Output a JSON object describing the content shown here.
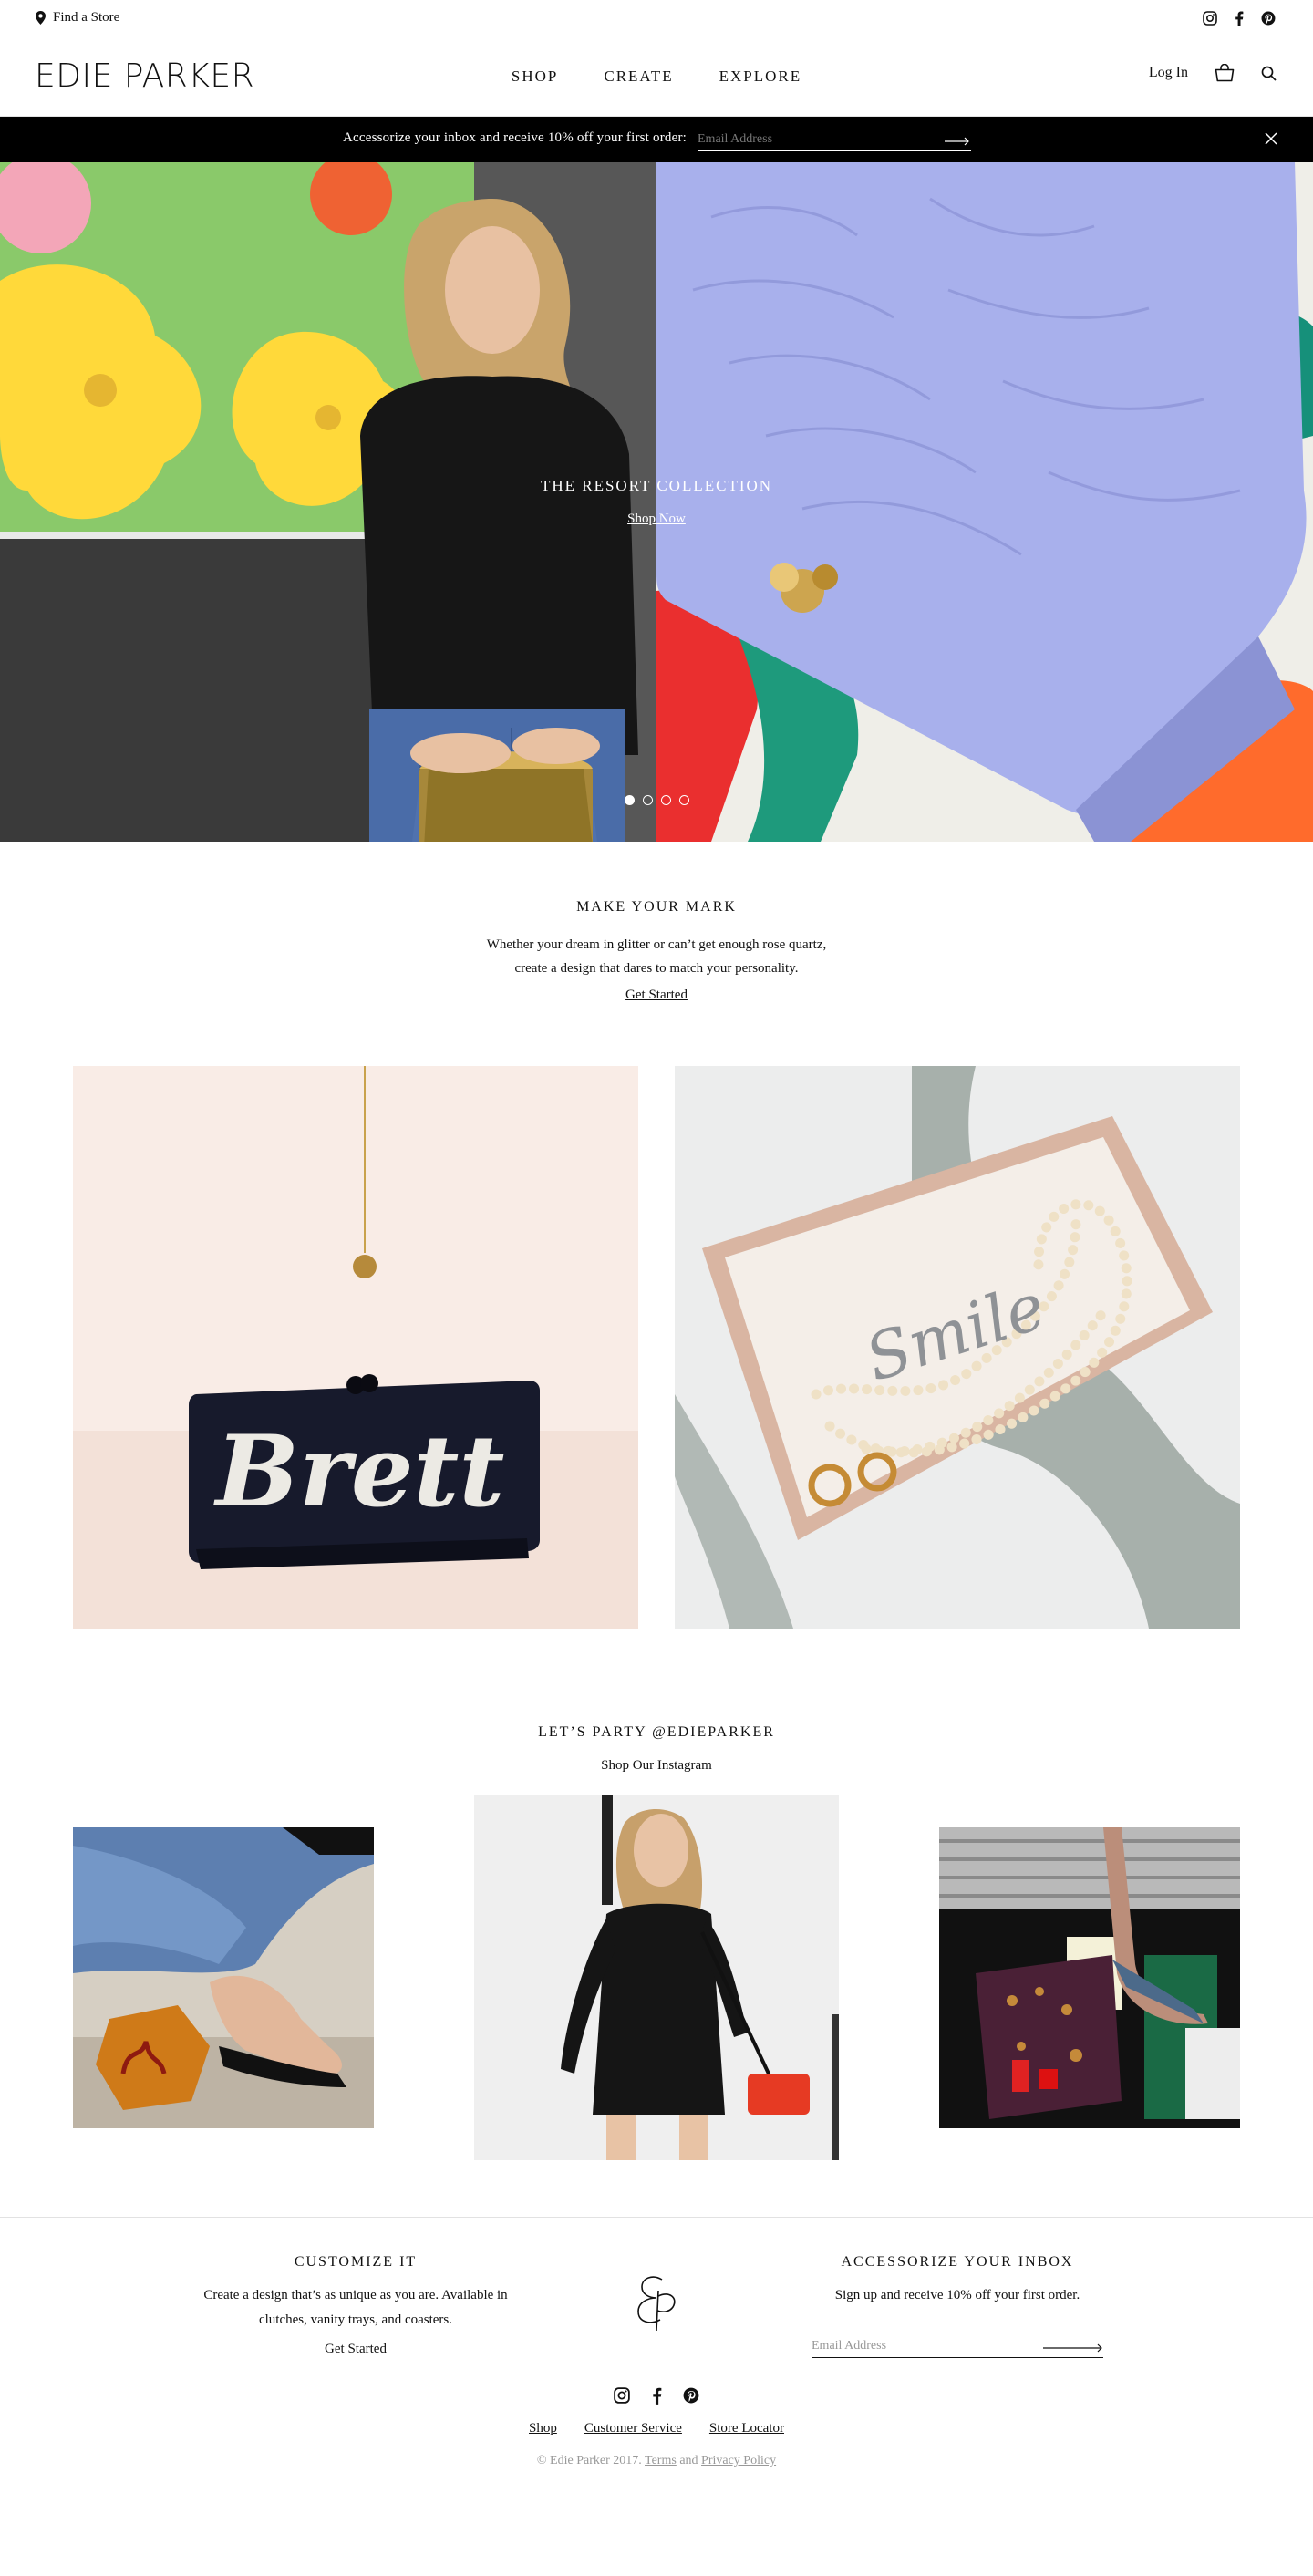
{
  "utility_bar": {
    "find_store": "Find a Store",
    "social": [
      "instagram-icon",
      "facebook-icon",
      "pinterest-icon"
    ]
  },
  "header": {
    "logo": "EDIE PARKER",
    "nav": [
      "SHOP",
      "CREATE",
      "EXPLORE"
    ],
    "login": "Log In",
    "icons": [
      "bag-icon",
      "search-icon"
    ]
  },
  "email_banner": {
    "text": "Accessorize your inbox and receive 10% off your first order:",
    "placeholder": "Email Address"
  },
  "hero": {
    "title": "THE RESORT COLLECTION",
    "link": "Shop Now",
    "slides": 4,
    "active_slide": 1
  },
  "make_your_mark": {
    "title": "MAKE YOUR MARK",
    "body_line1": "Whether your dream in glitter or can’t get enough rose quartz,",
    "body_line2": "create a design that dares to match your personality.",
    "link": "Get Started",
    "product_a_text": "Brett",
    "product_b_text": "Smile"
  },
  "instagram": {
    "title": "LET’S PARTY @EDIEPARKER",
    "subtitle": "Shop Our Instagram"
  },
  "footer": {
    "customize": {
      "title": "CUSTOMIZE IT",
      "body_line1": "Create a design that’s as unique as you are. Available in",
      "body_line2": "clutches, vanity trays, and coasters.",
      "link": "Get Started"
    },
    "newsletter": {
      "title": "ACCESSORIZE YOUR INBOX",
      "body": "Sign up and receive 10% off your first order.",
      "placeholder": "Email Address"
    },
    "links": [
      "Shop",
      "Customer Service",
      "Store Locator"
    ],
    "copyright": "© Edie Parker 2017.",
    "terms": "Terms",
    "and": "and",
    "privacy": "Privacy Policy"
  }
}
